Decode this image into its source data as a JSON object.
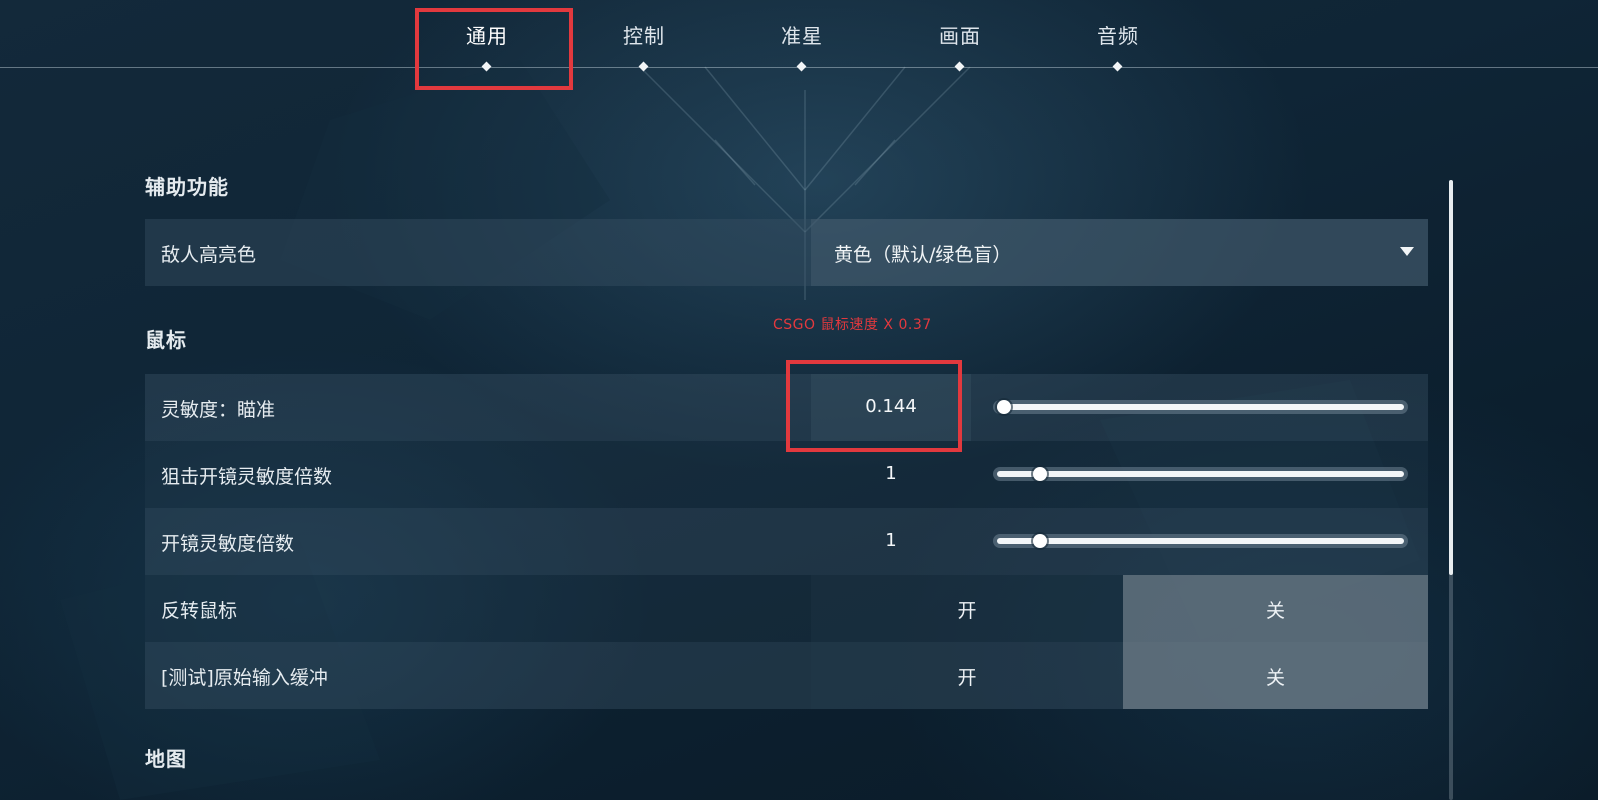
{
  "tabs": [
    {
      "label": "通用",
      "active": true
    },
    {
      "label": "控制",
      "active": false
    },
    {
      "label": "准星",
      "active": false
    },
    {
      "label": "画面",
      "active": false
    },
    {
      "label": "音频",
      "active": false
    }
  ],
  "sections": {
    "accessibility": {
      "title": "辅助功能",
      "enemy_highlight": {
        "label": "敌人高亮色",
        "value": "黄色（默认/绿色盲）"
      }
    },
    "mouse": {
      "title": "鼠标",
      "hint": "CSGO 鼠标速度 X 0.37",
      "sensitivity_aim": {
        "label": "灵敏度：瞄准",
        "value": "0.144",
        "level": 0.01
      },
      "sniper_zoom_multiplier": {
        "label": "狙击开镜灵敏度倍数",
        "value": "1",
        "level": 0.1
      },
      "zoom_multiplier": {
        "label": "开镜灵敏度倍数",
        "value": "1",
        "level": 0.1
      },
      "invert_mouse": {
        "label": "反转鼠标",
        "on_label": "开",
        "off_label": "关",
        "selected": "off"
      },
      "raw_input_buffer": {
        "label": "[测试]原始输入缓冲",
        "on_label": "开",
        "off_label": "关",
        "selected": "off"
      }
    },
    "map": {
      "title": "地图"
    }
  },
  "colors": {
    "highlight_red": "#e2393e",
    "toggle_selected": "#70808b",
    "text": "#e9eef2"
  }
}
